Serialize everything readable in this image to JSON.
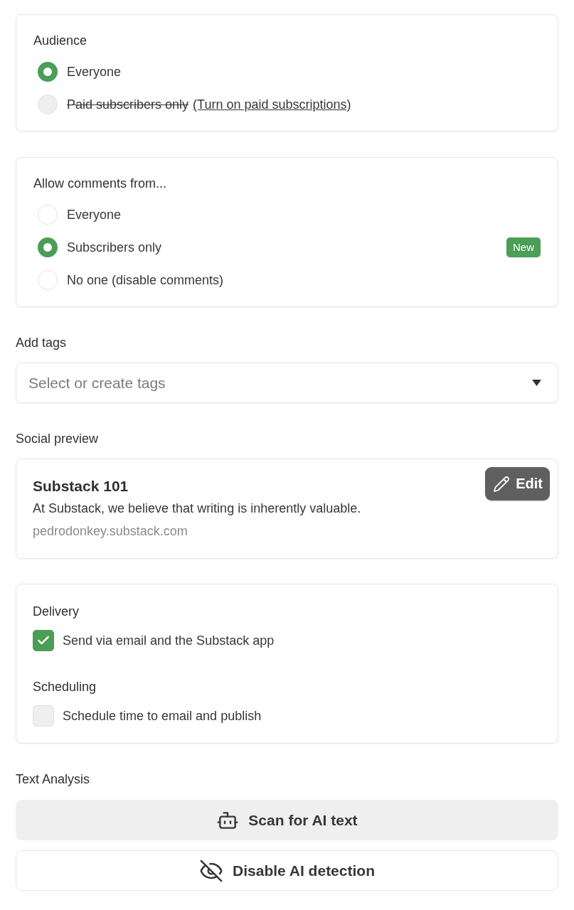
{
  "audience": {
    "title": "Audience",
    "options": [
      {
        "label": "Everyone",
        "selected": true,
        "disabled": false
      },
      {
        "label": "Paid subscribers only",
        "selected": false,
        "disabled": true,
        "link": "(Turn on paid subscriptions)"
      }
    ]
  },
  "comments": {
    "title": "Allow comments from...",
    "options": [
      {
        "label": "Everyone",
        "selected": false
      },
      {
        "label": "Subscribers only",
        "selected": true,
        "badge": "New"
      },
      {
        "label": "No one (disable comments)",
        "selected": false
      }
    ]
  },
  "tags": {
    "label": "Add tags",
    "placeholder": "Select or create tags"
  },
  "social_preview": {
    "label": "Social preview",
    "title": "Substack 101",
    "description": "At Substack, we believe that writing is inherently valuable.",
    "url": "pedrodonkey.substack.com",
    "edit_button": "Edit"
  },
  "delivery": {
    "sections": [
      {
        "title": "Delivery",
        "option": {
          "label": "Send via email and the Substack app",
          "checked": true
        }
      },
      {
        "title": "Scheduling",
        "option": {
          "label": "Schedule time to email and publish",
          "checked": false
        }
      }
    ]
  },
  "text_analysis": {
    "label": "Text Analysis",
    "buttons": [
      {
        "label": "Scan for AI text",
        "kind": "scan"
      },
      {
        "label": "Disable AI detection",
        "kind": "disable"
      }
    ]
  }
}
